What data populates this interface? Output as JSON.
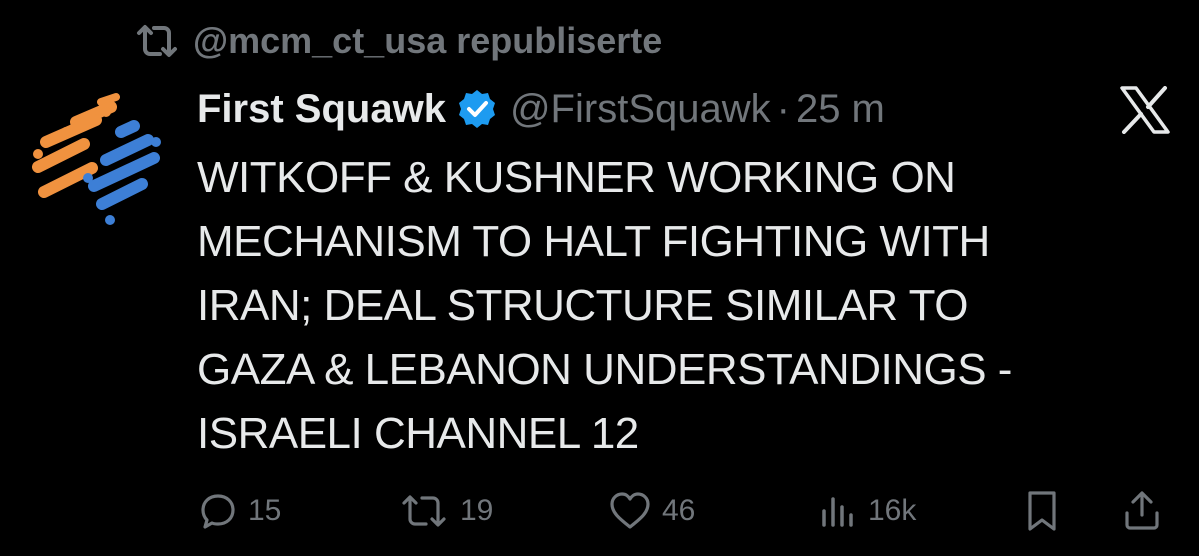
{
  "repost_header": {
    "icon": "repost-icon",
    "text": "@mcm_ct_usa republiserte"
  },
  "tweet": {
    "author_name": "First Squawk",
    "verified_icon": "verified-badge-icon",
    "handle": "@FirstSquawk",
    "separator": "·",
    "time": "25 m",
    "text_lines": [
      "WITKOFF & KUSHNER WORKING ON",
      "MECHANISM TO HALT FIGHTING WITH",
      "IRAN; DEAL STRUCTURE SIMILAR TO",
      "GAZA & LEBANON UNDERSTANDINGS -",
      "ISRAELI CHANNEL 12"
    ]
  },
  "brand_icon": "x-logo-icon",
  "actions": {
    "reply_count": "15",
    "repost_count": "19",
    "like_count": "46",
    "views_count": "16k"
  },
  "colors": {
    "background": "#000000",
    "text": "#e7e9ea",
    "secondary": "#71767b",
    "verified": "#1d9bf0",
    "avatar_orange": "#f0923f",
    "avatar_blue": "#3d7fd6"
  }
}
